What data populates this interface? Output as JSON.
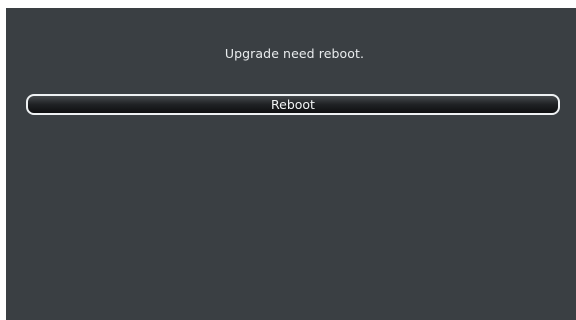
{
  "dialog": {
    "message": "Upgrade need reboot.",
    "reboot_label": "Reboot"
  },
  "colors": {
    "background": "#3a3f43",
    "text": "#e9ecee",
    "button_border": "#eef1f3"
  }
}
